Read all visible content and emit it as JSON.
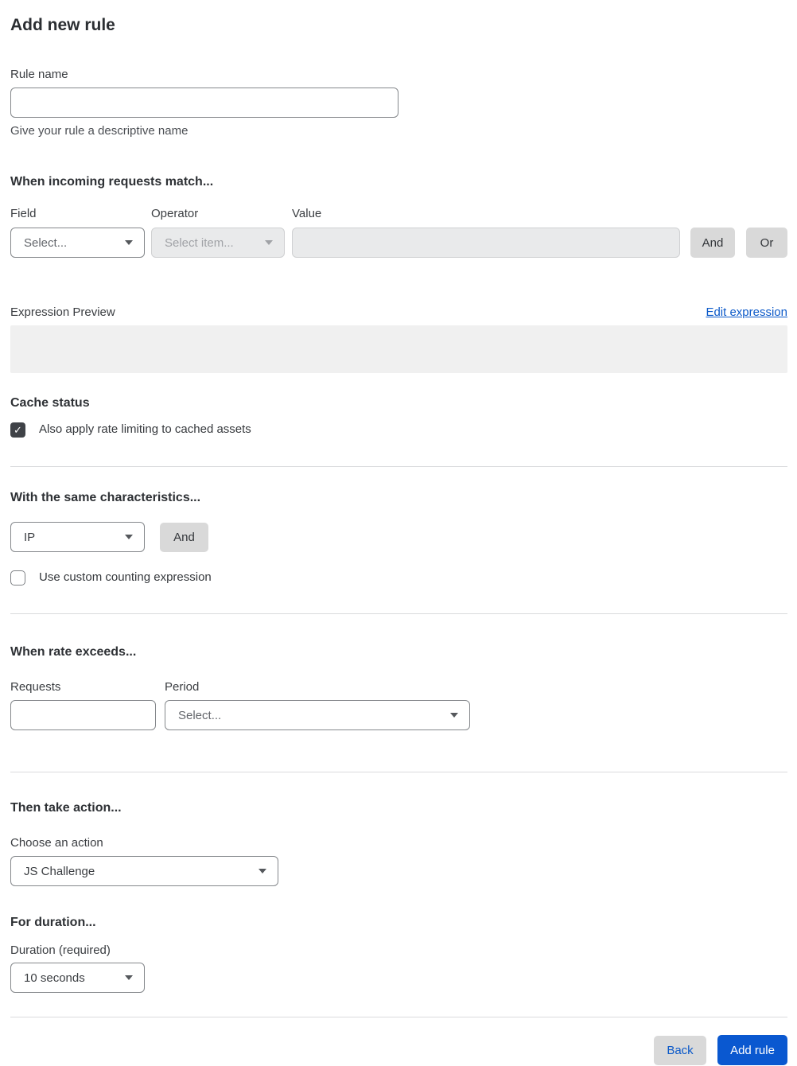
{
  "page": {
    "title": "Add new rule"
  },
  "rule_name": {
    "label": "Rule name",
    "value": "",
    "helper": "Give your rule a descriptive name"
  },
  "match_section": {
    "heading": "When incoming requests match...",
    "field_label": "Field",
    "field_value": "Select...",
    "operator_label": "Operator",
    "operator_value": "Select item...",
    "value_label": "Value",
    "value_value": "",
    "and_label": "And",
    "or_label": "Or",
    "expression_preview_label": "Expression Preview",
    "edit_expression_label": "Edit expression",
    "expression_value": ""
  },
  "cache_status": {
    "heading": "Cache status",
    "checkbox_label": "Also apply rate limiting to cached assets",
    "checked": true
  },
  "characteristics": {
    "heading": "With the same characteristics...",
    "select_value": "IP",
    "and_label": "And",
    "checkbox_label": "Use custom counting expression",
    "checked": false
  },
  "rate": {
    "heading": "When rate exceeds...",
    "requests_label": "Requests",
    "requests_value": "",
    "period_label": "Period",
    "period_value": "Select..."
  },
  "action": {
    "heading": "Then take action...",
    "choose_label": "Choose an action",
    "value": "JS Challenge"
  },
  "duration": {
    "heading": "For duration...",
    "label": "Duration (required)",
    "value": "10 seconds"
  },
  "footer": {
    "back_label": "Back",
    "add_label": "Add rule"
  },
  "icons": {
    "check_glyph": "✓"
  },
  "colors": {
    "accent_blue": "#0a58d0",
    "link_blue": "#0b59c9",
    "button_gray": "#d9d9d9",
    "disabled_bg": "#e9eaeb",
    "preview_bg": "#f0f0f0",
    "checkbox_checked": "#3f4247"
  }
}
